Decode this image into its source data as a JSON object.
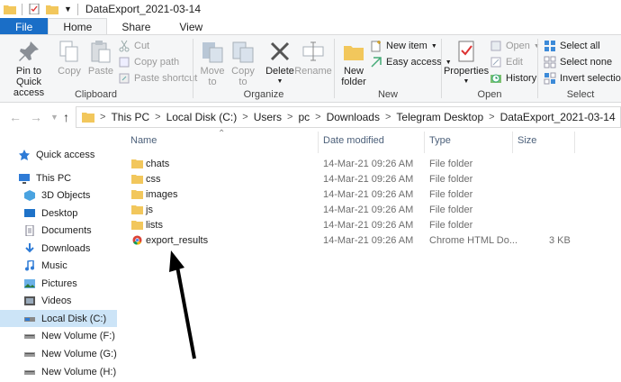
{
  "window": {
    "title": "DataExport_2021-03-14"
  },
  "tabs": [
    {
      "label": "File"
    },
    {
      "label": "Home"
    },
    {
      "label": "Share"
    },
    {
      "label": "View"
    }
  ],
  "ribbon": {
    "clipboard": {
      "label": "Clipboard",
      "pin": "Pin to Quick access",
      "pin_l1": "Pin to Quick",
      "pin_l2": "access",
      "copy": "Copy",
      "paste": "Paste",
      "cut": "Cut",
      "copy_path": "Copy path",
      "paste_shortcut": "Paste shortcut"
    },
    "organize": {
      "label": "Organize",
      "move_to": "Move to",
      "move_l1": "Move",
      "move_l2": "to",
      "copy_to": "Copy to",
      "copyto_l1": "Copy",
      "copyto_l2": "to",
      "delete": "Delete",
      "rename": "Rename"
    },
    "new": {
      "label": "New",
      "new_folder_l1": "New",
      "new_folder_l2": "folder",
      "new_item": "New item",
      "easy_access": "Easy access"
    },
    "open": {
      "label": "Open",
      "properties": "Properties",
      "open": "Open",
      "edit": "Edit",
      "history": "History"
    },
    "select": {
      "label": "Select",
      "select_all": "Select all",
      "select_none": "Select none",
      "invert": "Invert selection"
    }
  },
  "address": {
    "breadcrumbs": [
      "This PC",
      "Local Disk (C:)",
      "Users",
      "pc",
      "Downloads",
      "Telegram Desktop",
      "DataExport_2021-03-14"
    ]
  },
  "navpane": {
    "items": [
      {
        "label": "Quick access",
        "icon": "star-icon"
      },
      {
        "label": "This PC",
        "icon": "computer-icon"
      },
      {
        "label": "3D Objects",
        "icon": "cube-icon"
      },
      {
        "label": "Desktop",
        "icon": "desktop-icon"
      },
      {
        "label": "Documents",
        "icon": "documents-icon"
      },
      {
        "label": "Downloads",
        "icon": "download-icon"
      },
      {
        "label": "Music",
        "icon": "music-icon"
      },
      {
        "label": "Pictures",
        "icon": "pictures-icon"
      },
      {
        "label": "Videos",
        "icon": "videos-icon"
      },
      {
        "label": "Local Disk (C:)",
        "icon": "drive-icon",
        "selected": true
      },
      {
        "label": "New Volume (F:)",
        "icon": "drive-icon"
      },
      {
        "label": "New Volume (G:)",
        "icon": "drive-icon"
      },
      {
        "label": "New Volume (H:)",
        "icon": "drive-icon"
      }
    ]
  },
  "filelist": {
    "columns": [
      "Name",
      "Date modified",
      "Type",
      "Size"
    ],
    "rows": [
      {
        "name": "chats",
        "date": "14-Mar-21 09:26 AM",
        "type": "File folder",
        "size": "",
        "icon": "folder-icon"
      },
      {
        "name": "css",
        "date": "14-Mar-21 09:26 AM",
        "type": "File folder",
        "size": "",
        "icon": "folder-icon"
      },
      {
        "name": "images",
        "date": "14-Mar-21 09:26 AM",
        "type": "File folder",
        "size": "",
        "icon": "folder-icon"
      },
      {
        "name": "js",
        "date": "14-Mar-21 09:26 AM",
        "type": "File folder",
        "size": "",
        "icon": "folder-icon"
      },
      {
        "name": "lists",
        "date": "14-Mar-21 09:26 AM",
        "type": "File folder",
        "size": "",
        "icon": "folder-icon"
      },
      {
        "name": "export_results",
        "date": "14-Mar-21 09:26 AM",
        "type": "Chrome HTML Do...",
        "size": "3 KB",
        "icon": "chrome-icon"
      }
    ]
  },
  "colors": {
    "accent": "#1a6ec7",
    "folder": "#f2c75c",
    "selected": "#cce4f7",
    "annotation": "#000000"
  }
}
